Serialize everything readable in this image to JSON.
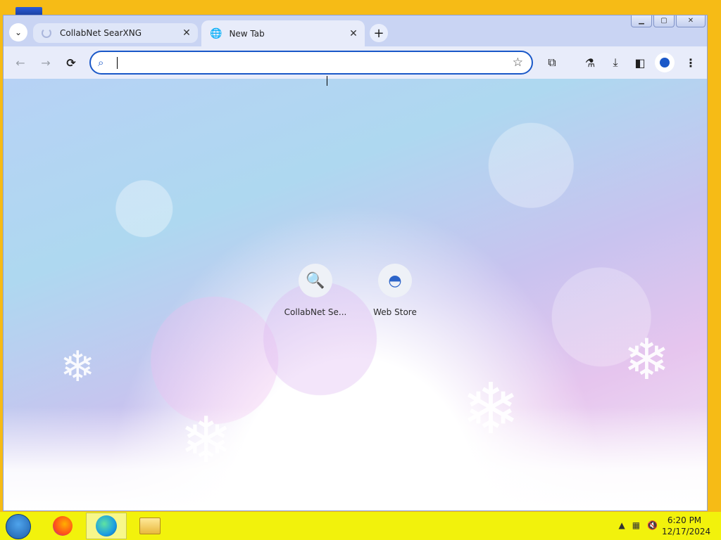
{
  "browser": {
    "tabs": [
      {
        "title": "CollabNet SearXNG",
        "state": "loading",
        "close": "✕"
      },
      {
        "title": "New Tab",
        "state": "active",
        "close": "✕"
      }
    ],
    "tab_search_icon": "chevron-down-icon",
    "new_tab_label": "+",
    "window_controls": {
      "minimize": "▁",
      "maximize": "▢",
      "close": "✕"
    },
    "toolbar": {
      "back": "←",
      "forward": "→",
      "reload": "⟳",
      "omnibox_value": "",
      "bookmark_star": "☆",
      "extensions": "⧉",
      "labs": "⚗",
      "downloads": "⤓",
      "side_panel": "◧",
      "menu": "⋮"
    },
    "accent_color": "#1a58c8",
    "shortcuts": [
      {
        "label": "CollabNet Se...",
        "icon": "🔍"
      },
      {
        "label": "Web Store",
        "icon": "◓"
      }
    ]
  },
  "taskbar": {
    "tray_icons": {
      "show_hidden": "▲",
      "network": "▦",
      "volume": "🔇"
    },
    "clock": {
      "time": "6:20 PM",
      "date": "12/17/2024"
    }
  }
}
